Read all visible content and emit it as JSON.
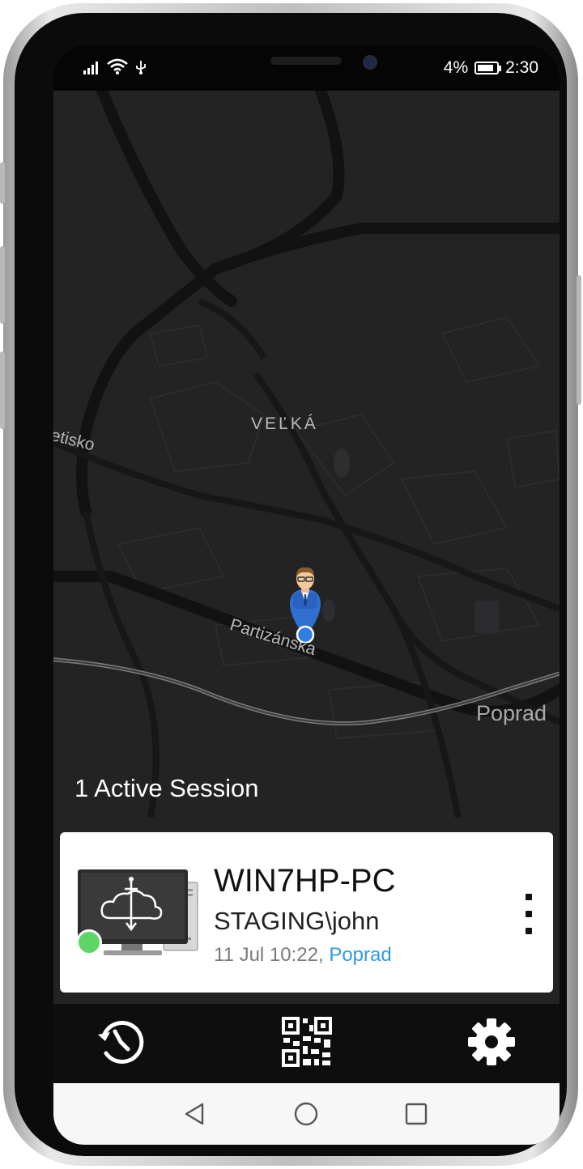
{
  "status_bar": {
    "battery_percent": "4%",
    "battery_level": 0.04,
    "time": "2:30",
    "icons": [
      "signal-icon",
      "wifi-icon",
      "usb-icon"
    ]
  },
  "map": {
    "labels": {
      "district": "VEĽKÁ",
      "street": "Partizánska",
      "town": "Poprad",
      "partial": "etisko"
    }
  },
  "sessions": {
    "header": "1 Active Session",
    "items": [
      {
        "hostname": "WIN7HP-PC",
        "user": "STAGING\\john",
        "datetime": "11 Jul 10:22, ",
        "location": "Poprad",
        "status": "online",
        "status_color": "#5fd467"
      }
    ]
  },
  "bottom_nav": {
    "icons": [
      "history-icon",
      "qr-code-icon",
      "settings-icon"
    ]
  },
  "system_nav": {
    "icons": [
      "back-icon",
      "home-icon",
      "recents-icon"
    ]
  },
  "colors": {
    "map_background": "#232324",
    "accent_link": "#2f9be0",
    "pin_blue": "#2f7fe0"
  }
}
